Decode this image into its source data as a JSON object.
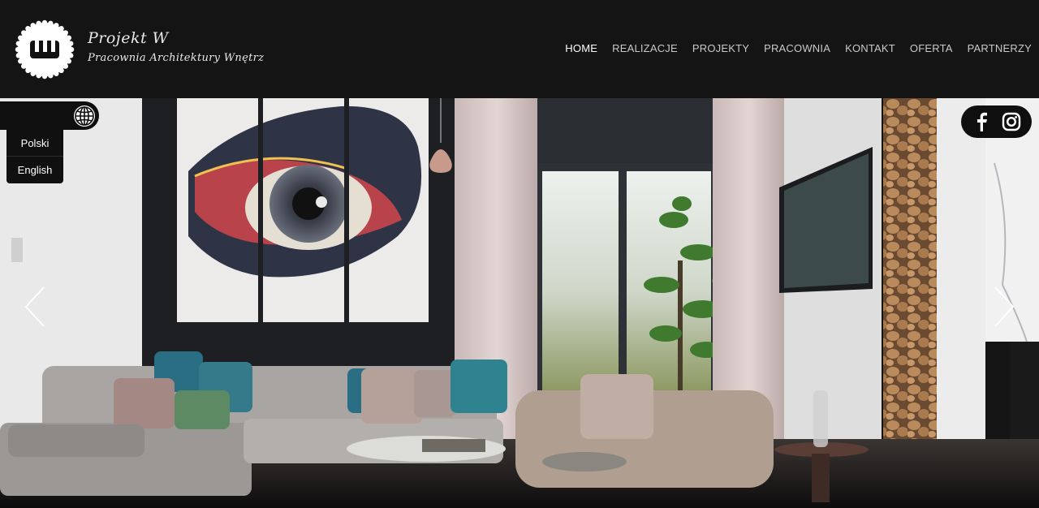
{
  "brand": {
    "logo_letter": "W",
    "script_line1": "Projekt W",
    "script_line2": "Pracownia Architektury Wnętrz"
  },
  "nav": {
    "items": [
      {
        "label": "HOME",
        "active": true
      },
      {
        "label": "REALIZACJE",
        "active": false
      },
      {
        "label": "PROJEKTY",
        "active": false
      },
      {
        "label": "PRACOWNIA",
        "active": false
      },
      {
        "label": "KONTAKT",
        "active": false
      },
      {
        "label": "OFERTA",
        "active": false
      },
      {
        "label": "PARTNERZY",
        "active": false
      }
    ]
  },
  "language": {
    "icon": "globe-icon",
    "options": [
      "Polski",
      "English"
    ]
  },
  "social": {
    "icons": [
      "facebook-icon",
      "instagram-icon"
    ]
  },
  "slider": {
    "prev_icon": "chevron-left-icon",
    "next_icon": "chevron-right-icon",
    "image": "living room interior with large eye painting triptych, sofa, plants and firewood wall"
  },
  "colors": {
    "header_bg": "#141414",
    "nav_text": "#c9c9c9",
    "nav_active": "#ffffff"
  }
}
